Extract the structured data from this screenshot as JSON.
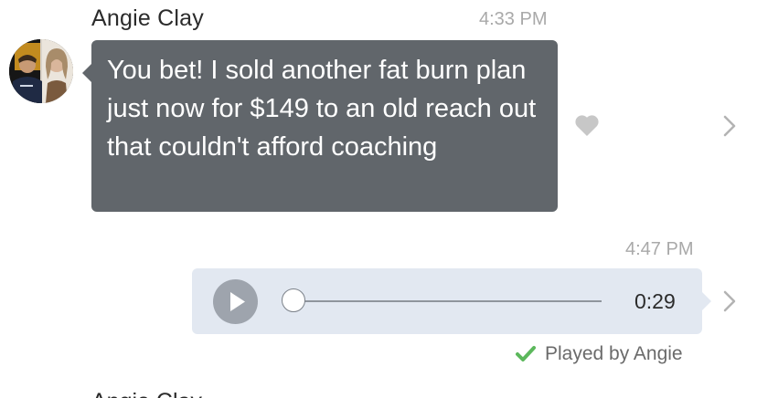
{
  "conversation": {
    "incoming_message": {
      "sender": "Angie Clay",
      "timestamp": "4:33 PM",
      "text": "You bet! I sold another fat burn plan just now for $149 to an old reach out that couldn't afford coaching",
      "like_icon": "heart-icon",
      "details_icon": "chevron-right-icon"
    },
    "outgoing_voice_message": {
      "timestamp": "4:47 PM",
      "duration": "0:29",
      "progress": 0,
      "play_icon": "play-icon",
      "details_icon": "chevron-right-icon",
      "status": "Played by Angie",
      "status_icon": "check-icon"
    },
    "next_message": {
      "sender": "Angie Clay"
    }
  },
  "colors": {
    "incoming_bubble": "#61666b",
    "outgoing_bubble": "#e2e8f1",
    "played_check": "#5cb85c",
    "timestamp": "#a9a9a9"
  }
}
